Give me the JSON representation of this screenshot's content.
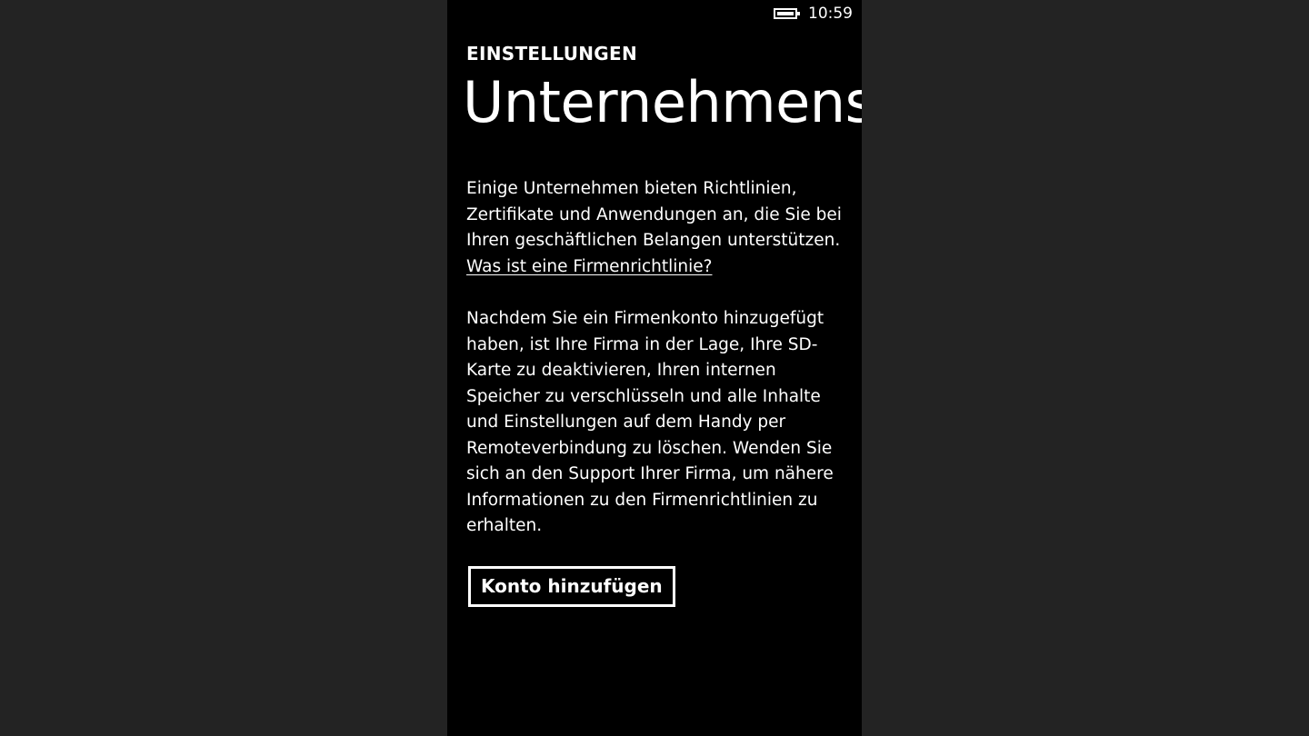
{
  "status_bar": {
    "battery_icon": "battery-full-icon",
    "time": "10:59"
  },
  "header": {
    "app_title": "EINSTELLUNGEN",
    "page_title": "Unternehmens-"
  },
  "content": {
    "paragraph1_text": "Einige Unternehmen bieten Richtlinien, Zertifikate und Anwendungen an, die Sie bei Ihren geschäftlichen Belangen unterstützen. ",
    "paragraph1_link": "Was ist eine Firmenrichtlinie?",
    "paragraph2": "Nachdem Sie ein Firmenkonto hinzugefügt haben, ist Ihre Firma in der Lage, Ihre SD-Karte zu deaktivieren, Ihren internen Speicher zu verschlüsseln und alle Inhalte und Einstellungen auf dem Handy per Remoteverbindung zu löschen. Wenden Sie sich an den Support Ihrer Firma, um nähere Informationen zu den Firmenrichtlinien zu erhalten."
  },
  "actions": {
    "add_account_label": "Konto hinzufügen"
  },
  "colors": {
    "background": "#000000",
    "outer_background": "#232323",
    "text": "#ffffff"
  }
}
